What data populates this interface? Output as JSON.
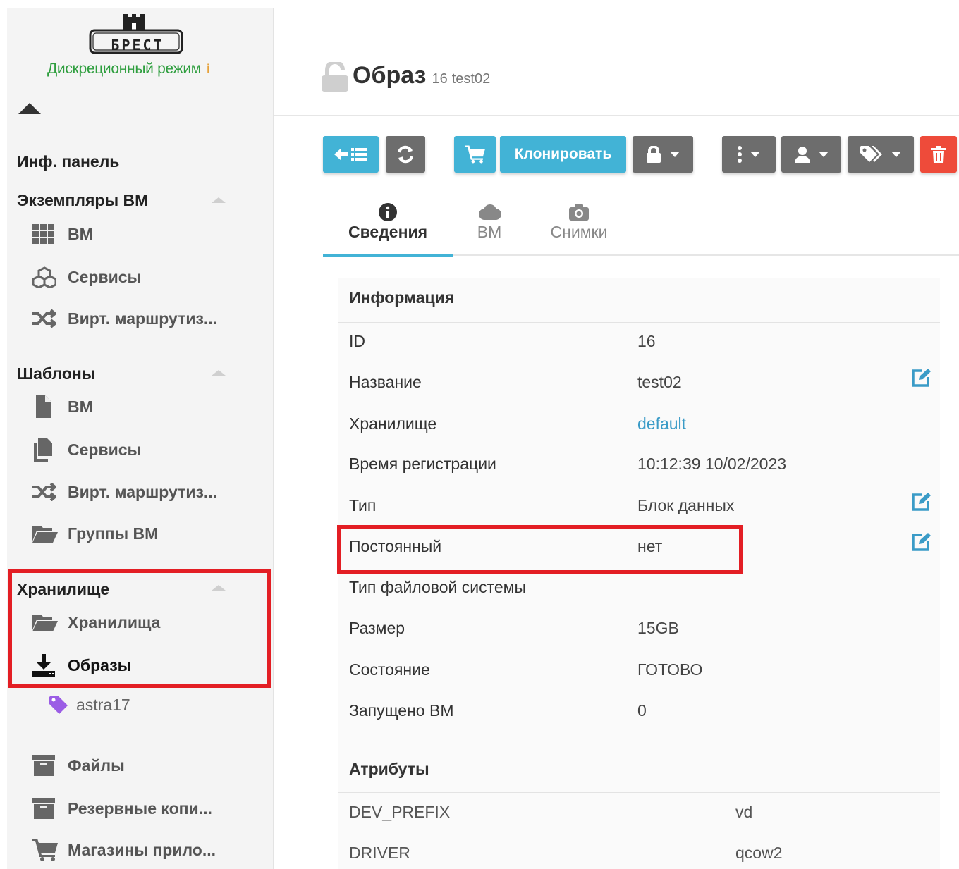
{
  "logo": {
    "text": "БРЕСТ",
    "mode": "Дискреционный режим",
    "info_icon": "info-icon"
  },
  "sidebar": {
    "dashboard": "Инф. панель",
    "instances": {
      "header": "Экземпляры ВМ",
      "items": [
        {
          "label": "ВМ",
          "icon": "grid-icon"
        },
        {
          "label": "Сервисы",
          "icon": "cubes-icon"
        },
        {
          "label": "Вирт. маршрутиз...",
          "icon": "shuffle-icon"
        }
      ]
    },
    "templates": {
      "header": "Шаблоны",
      "items": [
        {
          "label": "ВМ",
          "icon": "file-icon"
        },
        {
          "label": "Сервисы",
          "icon": "files-icon"
        },
        {
          "label": "Вирт. маршрутиз...",
          "icon": "shuffle-icon"
        },
        {
          "label": "Группы ВМ",
          "icon": "folder-open-icon"
        }
      ]
    },
    "storage": {
      "header": "Хранилище",
      "items": [
        {
          "label": "Хранилища",
          "icon": "folder-open-icon"
        },
        {
          "label": "Образы",
          "icon": "download-icon"
        }
      ],
      "sub_label": "astra17",
      "more": [
        {
          "label": "Файлы",
          "icon": "archive-icon"
        },
        {
          "label": "Резервные копи...",
          "icon": "archive-icon"
        },
        {
          "label": "Магазины прило...",
          "icon": "cart-icon"
        }
      ]
    }
  },
  "header": {
    "title": "Образ",
    "id": "16",
    "name": "test02"
  },
  "toolbar": {
    "clone_label": "Клонировать"
  },
  "tabs": [
    {
      "label": "Сведения",
      "icon": "info-circle-icon"
    },
    {
      "label": "ВМ",
      "icon": "cloud-icon"
    },
    {
      "label": "Снимки",
      "icon": "camera-icon"
    }
  ],
  "info": {
    "title": "Информация",
    "rows": [
      {
        "label": "ID",
        "value": "16"
      },
      {
        "label": "Название",
        "value": "test02"
      },
      {
        "label": "Хранилище",
        "value": "default"
      },
      {
        "label": "Время регистрации",
        "value": "10:12:39 10/02/2023"
      },
      {
        "label": "Тип",
        "value": "Блок данных"
      },
      {
        "label": "Постоянный",
        "value": "нет"
      },
      {
        "label": "Тип файловой системы",
        "value": ""
      },
      {
        "label": "Размер",
        "value": "15GB"
      },
      {
        "label": "Состояние",
        "value": "ГОТОВО"
      },
      {
        "label": "Запущено ВМ",
        "value": "0"
      }
    ]
  },
  "attributes": {
    "title": "Атрибуты",
    "rows": [
      {
        "label": "DEV_PREFIX",
        "value": "vd"
      },
      {
        "label": "DRIVER",
        "value": "qcow2"
      }
    ]
  },
  "colors": {
    "accent": "#42b3d6",
    "gray_button": "#6d6d6d",
    "danger": "#ee4b3a",
    "highlight": "#e31e24",
    "mode_text": "#2e9e3e",
    "link": "#3a9bc7"
  }
}
